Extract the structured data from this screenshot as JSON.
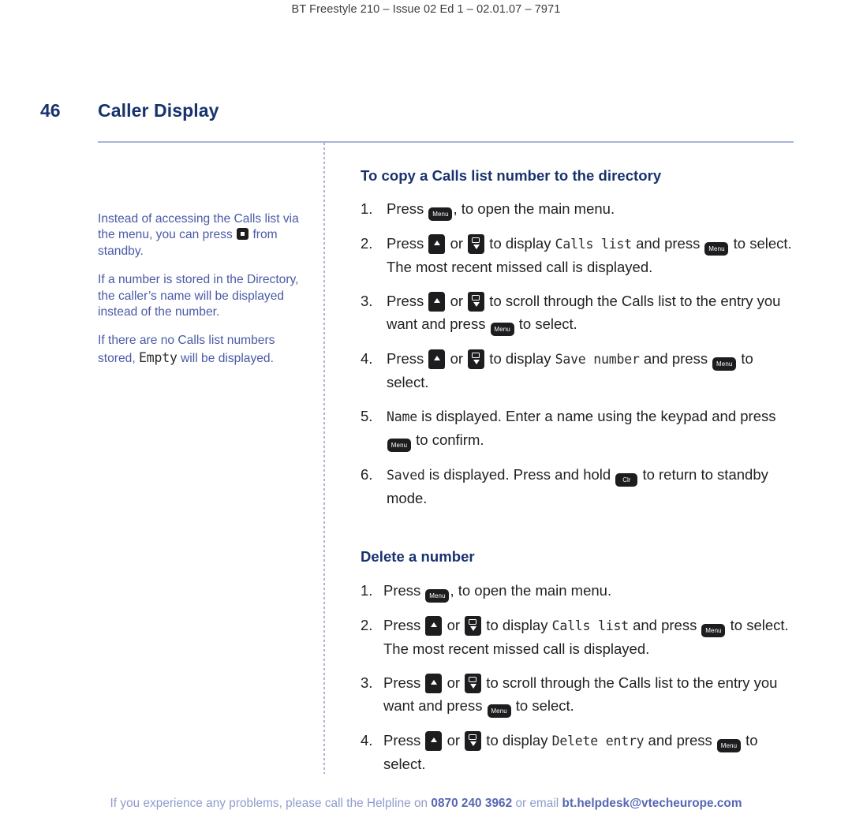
{
  "document": {
    "running_header": "BT Freestyle 210 – Issue 02 Ed 1 – 02.01.07 – 7971",
    "page_number": "46",
    "page_title": "Caller Display"
  },
  "colors": {
    "heading_navy": "#17326d",
    "note_blue": "#4a5aa6",
    "footer_blue": "#8e9ccd",
    "footer_bold_blue": "#5566b4",
    "rule_blue": "#aab4da",
    "key_black": "#1d1d1f"
  },
  "sidebar": {
    "notes": [
      {
        "part1": "Instead of accessing the Calls list via the menu, you can press",
        "key": "calls-list-key",
        "part2": "from standby."
      },
      {
        "part1": "If a number is stored in the Directory, the caller’s name will be displayed instead of the number.",
        "key": null,
        "part2": ""
      },
      {
        "part1": "If there are no Calls list numbers stored,",
        "lcd": "Empty",
        "part2": "will be displayed."
      }
    ]
  },
  "sections": [
    {
      "heading": "To copy a Calls list number to the directory",
      "steps": [
        {
          "num": "1.",
          "segments": [
            {
              "type": "text",
              "value": "Press "
            },
            {
              "type": "key",
              "key": "menu",
              "label": "Menu"
            },
            {
              "type": "text",
              "value": ", to open the main menu."
            }
          ]
        },
        {
          "num": "2.",
          "segments": [
            {
              "type": "text",
              "value": "Press "
            },
            {
              "type": "key",
              "key": "up",
              "label": ""
            },
            {
              "type": "text",
              "value": " or "
            },
            {
              "type": "key",
              "key": "down",
              "label": ""
            },
            {
              "type": "text",
              "value": " to display "
            },
            {
              "type": "lcd",
              "value": "Calls list"
            },
            {
              "type": "text",
              "value": " and press "
            },
            {
              "type": "key",
              "key": "menu",
              "label": "Menu"
            },
            {
              "type": "text",
              "value": " to select. The most recent missed call is displayed."
            }
          ]
        },
        {
          "num": "3.",
          "segments": [
            {
              "type": "text",
              "value": "Press "
            },
            {
              "type": "key",
              "key": "up",
              "label": ""
            },
            {
              "type": "text",
              "value": " or "
            },
            {
              "type": "key",
              "key": "down",
              "label": ""
            },
            {
              "type": "text",
              "value": " to scroll through the Calls list to the entry you want and press "
            },
            {
              "type": "key",
              "key": "menu",
              "label": "Menu"
            },
            {
              "type": "text",
              "value": " to select."
            }
          ]
        },
        {
          "num": "4.",
          "segments": [
            {
              "type": "text",
              "value": "Press "
            },
            {
              "type": "key",
              "key": "up",
              "label": ""
            },
            {
              "type": "text",
              "value": " or "
            },
            {
              "type": "key",
              "key": "down",
              "label": ""
            },
            {
              "type": "text",
              "value": " to display "
            },
            {
              "type": "lcd",
              "value": "Save number"
            },
            {
              "type": "text",
              "value": " and press "
            },
            {
              "type": "key",
              "key": "menu",
              "label": "Menu"
            },
            {
              "type": "text",
              "value": " to select."
            }
          ]
        },
        {
          "num": "5.",
          "segments": [
            {
              "type": "lcd",
              "value": "Name"
            },
            {
              "type": "text",
              "value": " is displayed. Enter a name using the keypad and press "
            },
            {
              "type": "key",
              "key": "menu",
              "label": "Menu"
            },
            {
              "type": "text",
              "value": " to confirm."
            }
          ]
        },
        {
          "num": "6.",
          "segments": [
            {
              "type": "lcd",
              "value": "Saved"
            },
            {
              "type": "text",
              "value": " is displayed. Press and hold "
            },
            {
              "type": "key",
              "key": "clr",
              "label": "Clr"
            },
            {
              "type": "text",
              "value": " to return to standby mode."
            }
          ]
        }
      ]
    },
    {
      "heading": "Delete a number",
      "steps": [
        {
          "num": "1.",
          "segments": [
            {
              "type": "text",
              "value": "Press "
            },
            {
              "type": "key",
              "key": "menu",
              "label": "Menu"
            },
            {
              "type": "text",
              "value": ", to open the main menu."
            }
          ]
        },
        {
          "num": "2.",
          "segments": [
            {
              "type": "text",
              "value": "Press "
            },
            {
              "type": "key",
              "key": "up",
              "label": ""
            },
            {
              "type": "text",
              "value": " or "
            },
            {
              "type": "key",
              "key": "down",
              "label": ""
            },
            {
              "type": "text",
              "value": " to display "
            },
            {
              "type": "lcd",
              "value": "Calls list"
            },
            {
              "type": "text",
              "value": " and press "
            },
            {
              "type": "key",
              "key": "menu",
              "label": "Menu"
            },
            {
              "type": "text",
              "value": " to select. The most recent missed call is displayed."
            }
          ]
        },
        {
          "num": "3.",
          "segments": [
            {
              "type": "text",
              "value": "Press "
            },
            {
              "type": "key",
              "key": "up",
              "label": ""
            },
            {
              "type": "text",
              "value": " or "
            },
            {
              "type": "key",
              "key": "down",
              "label": ""
            },
            {
              "type": "text",
              "value": " to scroll through the Calls list to the entry you want and press "
            },
            {
              "type": "key",
              "key": "menu",
              "label": "Menu"
            },
            {
              "type": "text",
              "value": " to select."
            }
          ]
        },
        {
          "num": "4.",
          "segments": [
            {
              "type": "text",
              "value": "Press "
            },
            {
              "type": "key",
              "key": "up",
              "label": ""
            },
            {
              "type": "text",
              "value": " or "
            },
            {
              "type": "key",
              "key": "down",
              "label": ""
            },
            {
              "type": "text",
              "value": " to display "
            },
            {
              "type": "lcd",
              "value": "Delete entry"
            },
            {
              "type": "text",
              "value": " and press "
            },
            {
              "type": "key",
              "key": "menu",
              "label": "Menu"
            },
            {
              "type": "text",
              "value": " to select."
            }
          ]
        }
      ]
    }
  ],
  "footer": {
    "lead": "If you experience any problems, please call the Helpline on ",
    "phone": "0870 240 3962",
    "middle": " or email ",
    "email": "bt.helpdesk@vtecheurope.com"
  }
}
